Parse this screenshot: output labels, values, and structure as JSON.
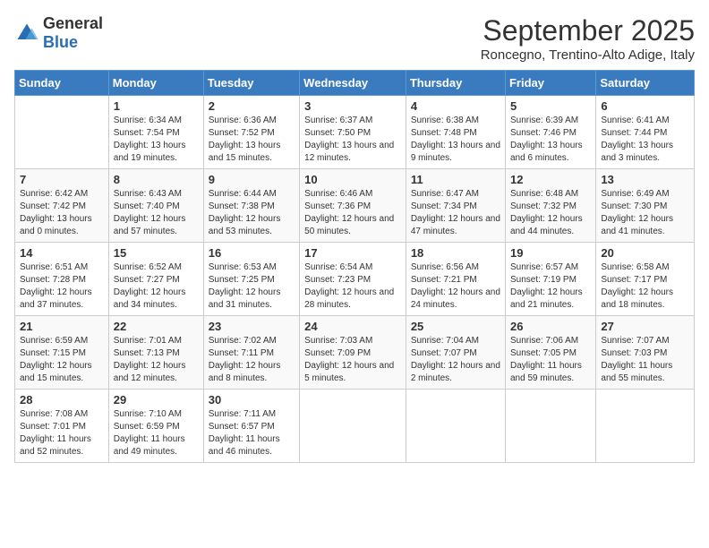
{
  "header": {
    "logo_general": "General",
    "logo_blue": "Blue",
    "month": "September 2025",
    "location": "Roncegno, Trentino-Alto Adige, Italy"
  },
  "weekdays": [
    "Sunday",
    "Monday",
    "Tuesday",
    "Wednesday",
    "Thursday",
    "Friday",
    "Saturday"
  ],
  "weeks": [
    [
      {
        "day": "",
        "sunrise": "",
        "sunset": "",
        "daylight": ""
      },
      {
        "day": "1",
        "sunrise": "Sunrise: 6:34 AM",
        "sunset": "Sunset: 7:54 PM",
        "daylight": "Daylight: 13 hours and 19 minutes."
      },
      {
        "day": "2",
        "sunrise": "Sunrise: 6:36 AM",
        "sunset": "Sunset: 7:52 PM",
        "daylight": "Daylight: 13 hours and 15 minutes."
      },
      {
        "day": "3",
        "sunrise": "Sunrise: 6:37 AM",
        "sunset": "Sunset: 7:50 PM",
        "daylight": "Daylight: 13 hours and 12 minutes."
      },
      {
        "day": "4",
        "sunrise": "Sunrise: 6:38 AM",
        "sunset": "Sunset: 7:48 PM",
        "daylight": "Daylight: 13 hours and 9 minutes."
      },
      {
        "day": "5",
        "sunrise": "Sunrise: 6:39 AM",
        "sunset": "Sunset: 7:46 PM",
        "daylight": "Daylight: 13 hours and 6 minutes."
      },
      {
        "day": "6",
        "sunrise": "Sunrise: 6:41 AM",
        "sunset": "Sunset: 7:44 PM",
        "daylight": "Daylight: 13 hours and 3 minutes."
      }
    ],
    [
      {
        "day": "7",
        "sunrise": "Sunrise: 6:42 AM",
        "sunset": "Sunset: 7:42 PM",
        "daylight": "Daylight: 13 hours and 0 minutes."
      },
      {
        "day": "8",
        "sunrise": "Sunrise: 6:43 AM",
        "sunset": "Sunset: 7:40 PM",
        "daylight": "Daylight: 12 hours and 57 minutes."
      },
      {
        "day": "9",
        "sunrise": "Sunrise: 6:44 AM",
        "sunset": "Sunset: 7:38 PM",
        "daylight": "Daylight: 12 hours and 53 minutes."
      },
      {
        "day": "10",
        "sunrise": "Sunrise: 6:46 AM",
        "sunset": "Sunset: 7:36 PM",
        "daylight": "Daylight: 12 hours and 50 minutes."
      },
      {
        "day": "11",
        "sunrise": "Sunrise: 6:47 AM",
        "sunset": "Sunset: 7:34 PM",
        "daylight": "Daylight: 12 hours and 47 minutes."
      },
      {
        "day": "12",
        "sunrise": "Sunrise: 6:48 AM",
        "sunset": "Sunset: 7:32 PM",
        "daylight": "Daylight: 12 hours and 44 minutes."
      },
      {
        "day": "13",
        "sunrise": "Sunrise: 6:49 AM",
        "sunset": "Sunset: 7:30 PM",
        "daylight": "Daylight: 12 hours and 41 minutes."
      }
    ],
    [
      {
        "day": "14",
        "sunrise": "Sunrise: 6:51 AM",
        "sunset": "Sunset: 7:28 PM",
        "daylight": "Daylight: 12 hours and 37 minutes."
      },
      {
        "day": "15",
        "sunrise": "Sunrise: 6:52 AM",
        "sunset": "Sunset: 7:27 PM",
        "daylight": "Daylight: 12 hours and 34 minutes."
      },
      {
        "day": "16",
        "sunrise": "Sunrise: 6:53 AM",
        "sunset": "Sunset: 7:25 PM",
        "daylight": "Daylight: 12 hours and 31 minutes."
      },
      {
        "day": "17",
        "sunrise": "Sunrise: 6:54 AM",
        "sunset": "Sunset: 7:23 PM",
        "daylight": "Daylight: 12 hours and 28 minutes."
      },
      {
        "day": "18",
        "sunrise": "Sunrise: 6:56 AM",
        "sunset": "Sunset: 7:21 PM",
        "daylight": "Daylight: 12 hours and 24 minutes."
      },
      {
        "day": "19",
        "sunrise": "Sunrise: 6:57 AM",
        "sunset": "Sunset: 7:19 PM",
        "daylight": "Daylight: 12 hours and 21 minutes."
      },
      {
        "day": "20",
        "sunrise": "Sunrise: 6:58 AM",
        "sunset": "Sunset: 7:17 PM",
        "daylight": "Daylight: 12 hours and 18 minutes."
      }
    ],
    [
      {
        "day": "21",
        "sunrise": "Sunrise: 6:59 AM",
        "sunset": "Sunset: 7:15 PM",
        "daylight": "Daylight: 12 hours and 15 minutes."
      },
      {
        "day": "22",
        "sunrise": "Sunrise: 7:01 AM",
        "sunset": "Sunset: 7:13 PM",
        "daylight": "Daylight: 12 hours and 12 minutes."
      },
      {
        "day": "23",
        "sunrise": "Sunrise: 7:02 AM",
        "sunset": "Sunset: 7:11 PM",
        "daylight": "Daylight: 12 hours and 8 minutes."
      },
      {
        "day": "24",
        "sunrise": "Sunrise: 7:03 AM",
        "sunset": "Sunset: 7:09 PM",
        "daylight": "Daylight: 12 hours and 5 minutes."
      },
      {
        "day": "25",
        "sunrise": "Sunrise: 7:04 AM",
        "sunset": "Sunset: 7:07 PM",
        "daylight": "Daylight: 12 hours and 2 minutes."
      },
      {
        "day": "26",
        "sunrise": "Sunrise: 7:06 AM",
        "sunset": "Sunset: 7:05 PM",
        "daylight": "Daylight: 11 hours and 59 minutes."
      },
      {
        "day": "27",
        "sunrise": "Sunrise: 7:07 AM",
        "sunset": "Sunset: 7:03 PM",
        "daylight": "Daylight: 11 hours and 55 minutes."
      }
    ],
    [
      {
        "day": "28",
        "sunrise": "Sunrise: 7:08 AM",
        "sunset": "Sunset: 7:01 PM",
        "daylight": "Daylight: 11 hours and 52 minutes."
      },
      {
        "day": "29",
        "sunrise": "Sunrise: 7:10 AM",
        "sunset": "Sunset: 6:59 PM",
        "daylight": "Daylight: 11 hours and 49 minutes."
      },
      {
        "day": "30",
        "sunrise": "Sunrise: 7:11 AM",
        "sunset": "Sunset: 6:57 PM",
        "daylight": "Daylight: 11 hours and 46 minutes."
      },
      {
        "day": "",
        "sunrise": "",
        "sunset": "",
        "daylight": ""
      },
      {
        "day": "",
        "sunrise": "",
        "sunset": "",
        "daylight": ""
      },
      {
        "day": "",
        "sunrise": "",
        "sunset": "",
        "daylight": ""
      },
      {
        "day": "",
        "sunrise": "",
        "sunset": "",
        "daylight": ""
      }
    ]
  ]
}
